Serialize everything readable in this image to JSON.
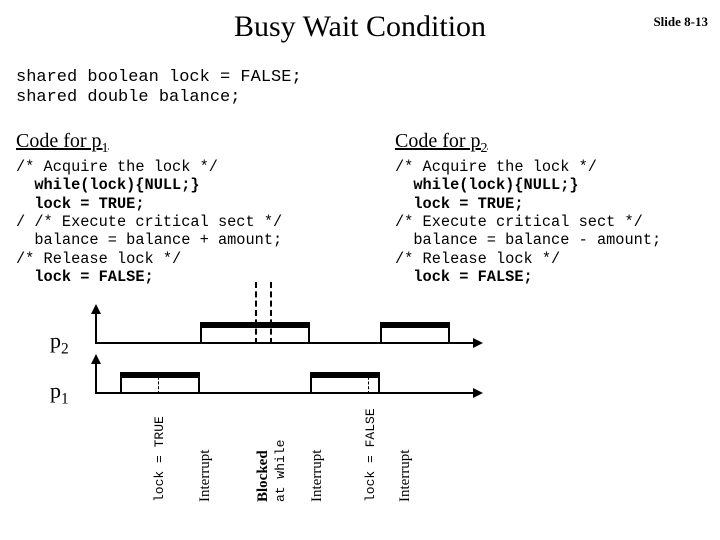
{
  "slide": {
    "title": "Busy Wait Condition",
    "number": "Slide 8-13"
  },
  "shared": "shared boolean lock = FALSE;\nshared double balance;",
  "headers": {
    "p1_prefix": "Code for p",
    "p1_sub": "1",
    "p2_prefix": "Code for p",
    "p2_sub": "2"
  },
  "code_p1": {
    "l1": "/* Acquire the lock */",
    "l2": "  while(lock){NULL;}",
    "l3": "  lock = TRUE;",
    "l4": "/ /* Execute critical sect */",
    "l5": "  balance = balance + amount;",
    "l6": "/* Release lock */",
    "l7": "  lock = FALSE;"
  },
  "code_p2": {
    "l1": "/* Acquire the lock */",
    "l2": "  while(lock){NULL;}",
    "l3": "  lock = TRUE;",
    "l4": "/* Execute critical sect */",
    "l5": "  balance = balance - amount;",
    "l6": "/* Release lock */",
    "l7": "  lock = FALSE;"
  },
  "diagram": {
    "lane_p2_prefix": "p",
    "lane_p2_sub": "2",
    "lane_p1_prefix": "p",
    "lane_p1_sub": "1",
    "labels": {
      "lock_true": "lock = TRUE",
      "interrupt": "Interrupt",
      "blocked": "Blocked",
      "at_while": "at while",
      "lock_false": "lock = FALSE"
    }
  }
}
